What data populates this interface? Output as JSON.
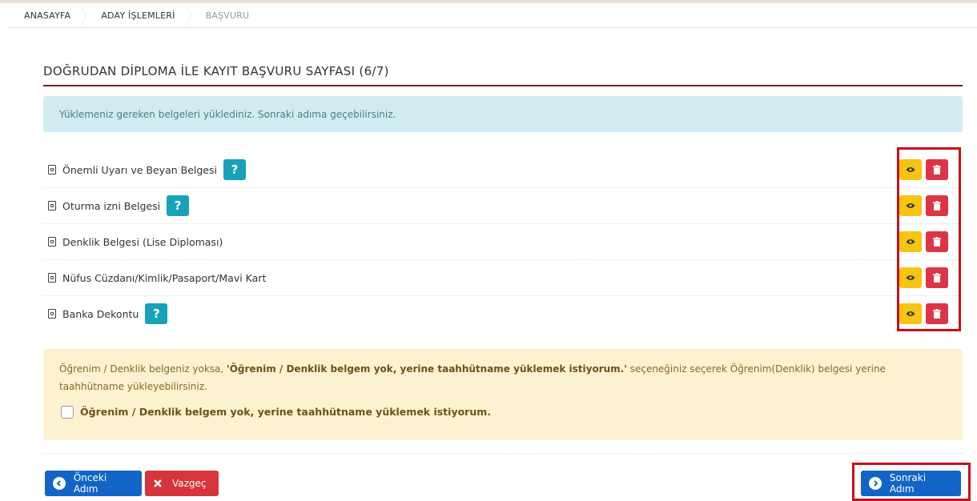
{
  "breadcrumb": {
    "items": [
      "ANASAYFA",
      "ADAY İŞLEMLERİ",
      "BAŞVURU"
    ]
  },
  "page": {
    "title": "DOĞRUDAN DİPLOMA İLE KAYIT BAŞVURU SAYFASI (6/7)",
    "info_message": "Yüklemeniz gereken belgeleri yüklediniz. Sonraki adıma geçebilirsiniz."
  },
  "documents": [
    {
      "label": "Önemli Uyarı ve Beyan Belgesi",
      "help": "?"
    },
    {
      "label": "Oturma izni Belgesi",
      "help": "?"
    },
    {
      "label": "Denklik Belgesi (Lise Diploması)",
      "help": ""
    },
    {
      "label": "Nüfus Cüzdanı/Kimlik/Pasaport/Mavi Kart",
      "help": ""
    },
    {
      "label": "Banka Dekontu",
      "help": "?"
    }
  ],
  "warning": {
    "text_before": "Öğrenim / Denklik belgeniz yoksa, ",
    "text_bold": "'Öğrenim / Denklik belgem yok, yerine taahhütname yüklemek istiyorum.'",
    "text_after": " seçeneğiniz seçerek Öğrenim(Denklik) belgesi yerine taahhütname yükleyebilirsiniz.",
    "checkbox_label": "Öğrenim / Denklik belgem yok, yerine taahhütname yüklemek istiyorum.",
    "checkbox_checked": false
  },
  "buttons": {
    "prev": "Önceki Adım",
    "cancel": "Vazgeç",
    "next": "Sonraki Adım"
  },
  "colors": {
    "info_bg": "#d1ecf1",
    "help": "#17a2b8",
    "view": "#f5c511",
    "delete": "#dc3545",
    "primary": "#1265c6",
    "highlight_frame": "#c8101b"
  },
  "icons": {
    "document": "file-icon",
    "view": "eye-icon",
    "delete": "trash-icon",
    "prev": "arrow-left-circle-icon",
    "cancel": "close-icon",
    "next": "arrow-right-circle-icon"
  }
}
